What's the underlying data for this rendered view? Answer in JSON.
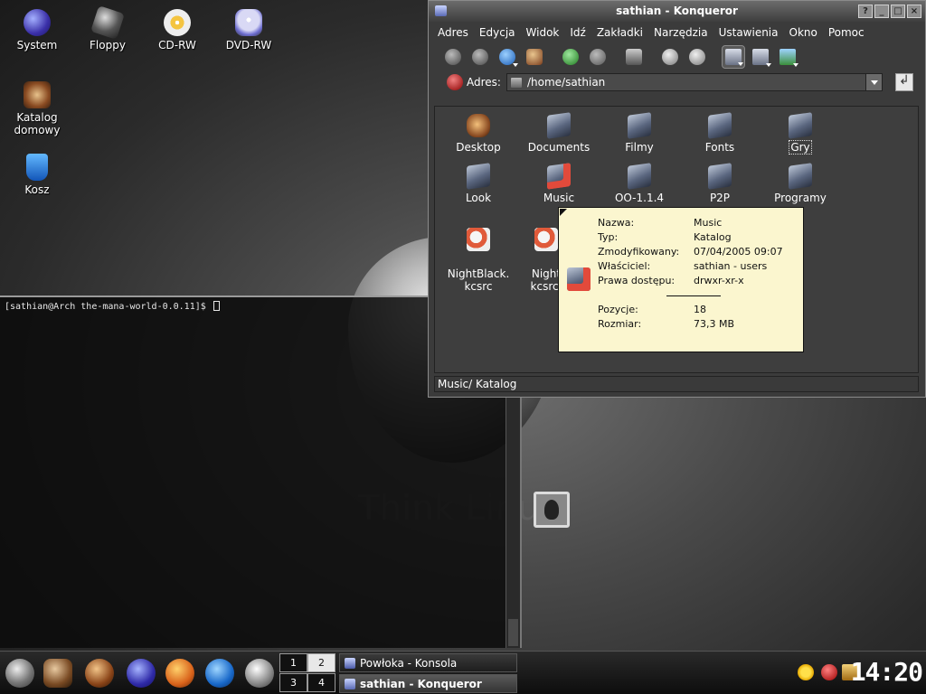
{
  "wallpaper": {
    "slogan": "Think Linux"
  },
  "desktop_icons": [
    {
      "name": "System",
      "icon": "system-icon"
    },
    {
      "name": "Floppy",
      "icon": "floppy-icon"
    },
    {
      "name": "CD-RW",
      "icon": "cd-rw-icon"
    },
    {
      "name": "DVD-RW",
      "icon": "dvd-rw-icon"
    },
    {
      "name": "Katalog domowy",
      "icon": "home-folder-icon"
    },
    {
      "name": "Kosz",
      "icon": "trash-icon"
    }
  ],
  "terminal": {
    "prompt": "[sathian@Arch the-mana-world-0.0.11]$"
  },
  "konqueror": {
    "title": "sathian - Konqueror",
    "window_buttons": [
      "?",
      "_",
      "□",
      "×"
    ],
    "menu": [
      "Adres",
      "Edycja",
      "Widok",
      "Idź",
      "Zakładki",
      "Narzędzia",
      "Ustawienia",
      "Okno",
      "Pomoc"
    ],
    "location": {
      "label": "Adres:",
      "value": "/home/sathian"
    },
    "files": [
      {
        "name": "Desktop",
        "kind": "desktop"
      },
      {
        "name": "Documents",
        "kind": "folder"
      },
      {
        "name": "Filmy",
        "kind": "folder"
      },
      {
        "name": "Fonts",
        "kind": "folder"
      },
      {
        "name": "Gry",
        "kind": "folder"
      },
      {
        "name": "Look",
        "kind": "folder"
      },
      {
        "name": "Music",
        "kind": "music"
      },
      {
        "name": "OO-1.1.4",
        "kind": "folder"
      },
      {
        "name": "P2P",
        "kind": "folder"
      },
      {
        "name": "Programy",
        "kind": "folder"
      },
      {
        "name": "NightBlack.\nkcsrc",
        "kind": "file"
      },
      {
        "name": "Night\nkcsrc.",
        "kind": "file"
      }
    ],
    "tooltip": {
      "rows": [
        {
          "k": "Nazwa:",
          "v": "Music"
        },
        {
          "k": "Typ:",
          "v": "Katalog"
        },
        {
          "k": "Zmodyfikowany:",
          "v": "07/04/2005 09:07"
        },
        {
          "k": "Właściciel:",
          "v": "sathian - users"
        },
        {
          "k": "Prawa dostępu:",
          "v": "drwxr-xr-x"
        },
        {
          "k": "Pozycje:",
          "v": "18"
        },
        {
          "k": "Rozmiar:",
          "v": "73,3 MB"
        }
      ]
    },
    "status": "Music/  Katalog"
  },
  "taskbar": {
    "pager": [
      "1",
      "2",
      "3",
      "4"
    ],
    "active_desktop": 2,
    "tasks": [
      {
        "label": "Powłoka - Konsola",
        "active": false
      },
      {
        "label": "sathian - Konqueror",
        "active": true
      }
    ],
    "clock": "14:20"
  }
}
